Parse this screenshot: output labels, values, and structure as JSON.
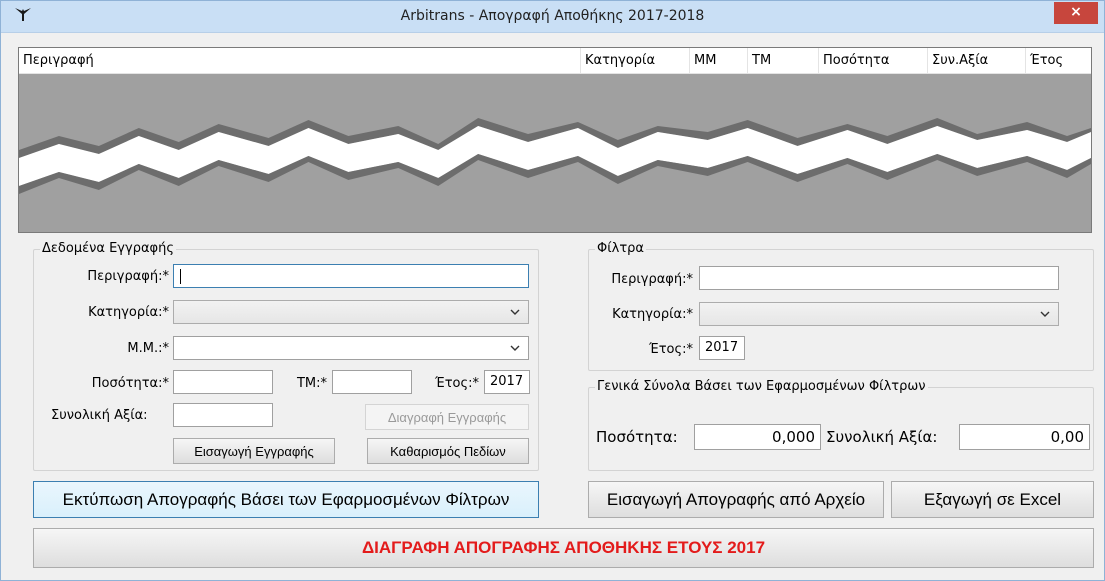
{
  "window": {
    "title": "Arbitrans - Απογραφή Αποθήκης 2017-2018",
    "close_label": "×"
  },
  "table": {
    "columns": [
      "Περιγραφή",
      "Κατηγορία",
      "ΜΜ",
      "ΤΜ",
      "Ποσότητα",
      "Συν.Αξία",
      "Έτος"
    ]
  },
  "record": {
    "legend": "Δεδομένα Εγγραφής",
    "description_label": "Περιγραφή:*",
    "description_value": "",
    "category_label": "Κατηγορία:*",
    "category_value": "",
    "unit_label": "Μ.Μ.:*",
    "unit_value": "",
    "quantity_label": "Ποσότητα:*",
    "quantity_value": "",
    "tm_label": "ΤΜ:*",
    "tm_value": "",
    "year_label": "Έτος:*",
    "year_value": "2017",
    "total_label": "Συνολική Αξία:",
    "total_value": "",
    "delete_button": "Διαγραφή Εγγραφής",
    "insert_button": "Εισαγωγή Εγγραφής",
    "clear_button": "Καθαρισμός Πεδίων"
  },
  "filters": {
    "legend": "Φίλτρα",
    "description_label": "Περιγραφή:*",
    "description_value": "",
    "category_label": "Κατηγορία:*",
    "category_value": "",
    "year_label": "Έτος:*",
    "year_value": "2017"
  },
  "totals": {
    "legend": "Γενικά Σύνολα Βάσει των Εφαρμοσμένων Φίλτρων",
    "quantity_label": "Ποσότητα:",
    "quantity_value": "0,000",
    "total_label": "Συνολική Αξία:",
    "total_value": "0,00"
  },
  "actions": {
    "print_button": "Εκτύπωση Απογραφής Βάσει των Εφαρμοσμένων Φίλτρων",
    "import_button": "Εισαγωγή Απογραφής από Αρχείο",
    "export_button": "Εξαγωγή σε Excel",
    "delete_all_button": "ΔΙΑΓΡΑΦΗ ΑΠΟΓΡΑΦΗΣ ΑΠΟΘΗΚΗΣ ΕΤΟΥΣ 2017"
  }
}
